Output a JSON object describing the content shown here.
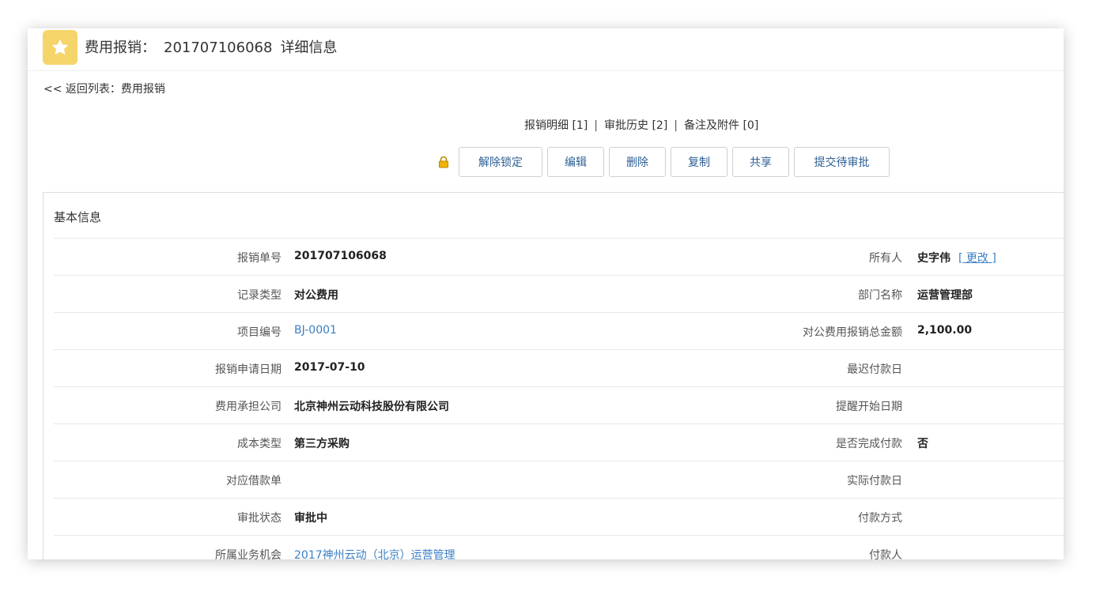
{
  "header": {
    "title_prefix": "费用报销：",
    "record_id": "201707106068",
    "title_suffix": "详细信息"
  },
  "back_link": "<< 返回列表：费用报销",
  "subnav": {
    "items": [
      "报销明细 [1]",
      "审批历史 [2]",
      "备注及附件 [0]"
    ],
    "separator": "|"
  },
  "toolbar": {
    "unlock": "解除锁定",
    "edit": "编辑",
    "delete": "删除",
    "copy": "复制",
    "share": "共享",
    "submit": "提交待审批"
  },
  "section": {
    "title": "基本信息"
  },
  "fields": {
    "rows": [
      {
        "left_label": "报销单号",
        "left_value": "201707106068",
        "right_label": "所有人",
        "right_value": "史字伟"
      },
      {
        "left_label": "记录类型",
        "left_value": "对公费用",
        "right_label": "部门名称",
        "right_value": "运营管理部"
      },
      {
        "left_label": "项目编号",
        "left_value": "BJ-0001",
        "right_label": "对公费用报销总金额",
        "right_value": "2,100.00"
      },
      {
        "left_label": "报销申请日期",
        "left_value": "2017-07-10",
        "right_label": "最迟付款日",
        "right_value": ""
      },
      {
        "left_label": "费用承担公司",
        "left_value": "北京神州云动科技股份有限公司",
        "right_label": "提醒开始日期",
        "right_value": ""
      },
      {
        "left_label": "成本类型",
        "left_value": "第三方采购",
        "right_label": "是否完成付款",
        "right_value": "否"
      },
      {
        "left_label": "对应借款单",
        "left_value": "",
        "right_label": "实际付款日",
        "right_value": ""
      },
      {
        "left_label": "审批状态",
        "left_value": "审批中",
        "right_label": "付款方式",
        "right_value": ""
      },
      {
        "left_label": "所属业务机会",
        "left_value": "2017神州云动（北京）运营管理",
        "right_label": "付款人",
        "right_value": ""
      }
    ],
    "owner_change_link": "[ 更改 ]"
  },
  "colors": {
    "link": "#3a7fc4",
    "button_text": "#2c5f93",
    "star_badge": "#f5d56a",
    "lock": "#f0b400"
  },
  "icons": {
    "header": "star-icon",
    "toolbar": "lock-icon"
  }
}
